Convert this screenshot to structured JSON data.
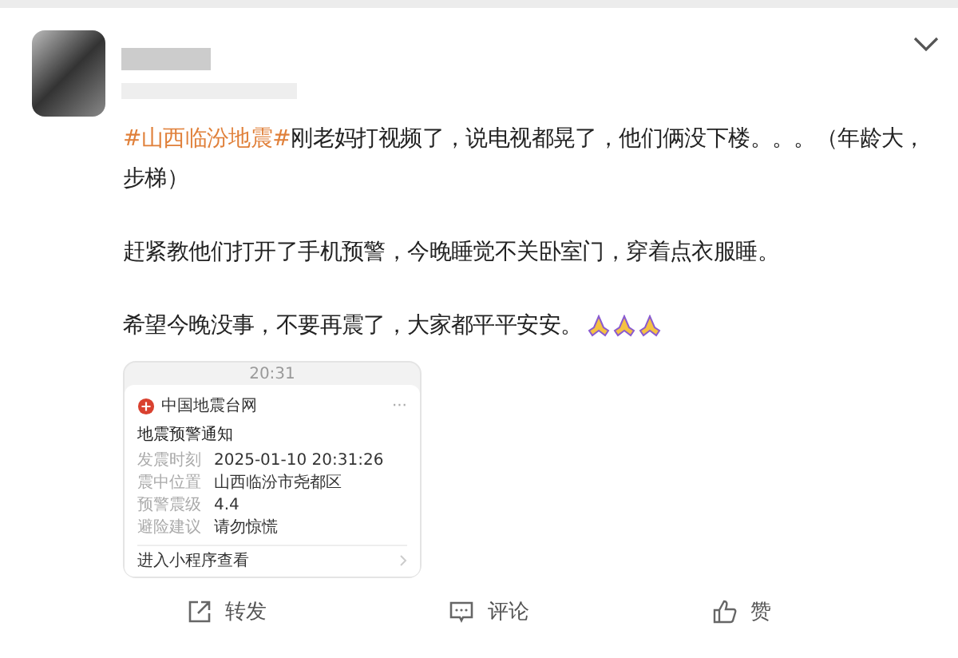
{
  "post": {
    "paragraphs": [
      {
        "hashtag": "#山西临汾地震#",
        "text": "刚老妈打视频了，说电视都晃了，他们俩没下楼。。。（年龄大，步梯）"
      },
      {
        "text": "赶紧教他们打开了手机预警，今晚睡觉不关卧室门，穿着点衣服睡。"
      },
      {
        "text": "希望今晚没事，不要再震了，大家都平平安安。"
      }
    ],
    "screenshot": {
      "time": "20:31",
      "app": "中国地震台网",
      "more": "···",
      "title": "地震预警通知",
      "rows": [
        {
          "label": "发震时刻",
          "value": "2025-01-10 20:31:26"
        },
        {
          "label": "震中位置",
          "value": "山西临汾市尧都区"
        },
        {
          "label": "预警震级",
          "value": "4.4"
        },
        {
          "label": "避险建议",
          "value": "请勿惊慌"
        }
      ],
      "footer": "进入小程序查看"
    }
  },
  "actions": [
    {
      "kind": "share",
      "label": "转发"
    },
    {
      "kind": "comment",
      "label": "评论"
    },
    {
      "kind": "like",
      "label": "赞"
    }
  ]
}
